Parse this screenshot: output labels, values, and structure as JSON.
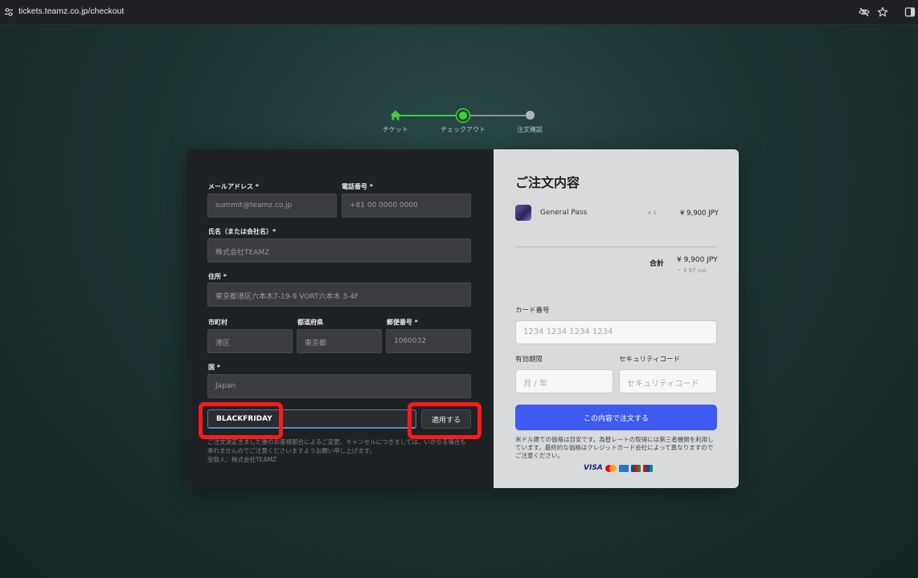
{
  "browser": {
    "url": "tickets.teamz.co.jp/checkout",
    "icons": [
      "site-settings-icon",
      "eye-off-icon",
      "star-icon",
      "sidebar-icon"
    ]
  },
  "stepper": {
    "steps": [
      {
        "label": "チケット",
        "icon": "home-icon",
        "state": "done"
      },
      {
        "label": "チェックアウト",
        "icon": "circle",
        "state": "current"
      },
      {
        "label": "注文確認",
        "icon": "dot",
        "state": "pending"
      }
    ],
    "colors": {
      "active": "#3fcf3f",
      "pending": "#b0b4b6"
    }
  },
  "form": {
    "email": {
      "label": "メールアドレス *",
      "value": "summit@teamz.co.jp"
    },
    "phone": {
      "label": "電話番号 *",
      "value": "+81 00 0000 0000"
    },
    "name": {
      "label": "氏名（または会社名）*",
      "value": "株式会社TEAMZ"
    },
    "address": {
      "label": "住所 *",
      "value": "東京都港区六本木7-19-9 VORT六本木 3-4F"
    },
    "city": {
      "label": "市町村",
      "value": "港区"
    },
    "prefecture": {
      "label": "都道府県",
      "value": "東京都"
    },
    "postal": {
      "label": "郵便番号 *",
      "value": "1060032"
    },
    "country": {
      "label": "国 *",
      "value": "Japan"
    },
    "coupon": {
      "value": "BLACKFRIDAY"
    },
    "apply_label": "適用する",
    "notice_lines": [
      "ご注文決定きました後のお客様都合によるご変更、キャンセルにつきましては、いかなる場合も",
      "承れませんのでご注意くださいますようお願い申し上げます。",
      "受取人：株式会社TEAMZ"
    ]
  },
  "summary": {
    "title": "ご注文内容",
    "item": {
      "name": "General Pass",
      "qty": "x 1",
      "price": "¥ 9,900 JPY"
    },
    "total_label": "合計",
    "total_value": "¥ 9,900 JPY",
    "total_usd": "~ $ 67",
    "total_usd_unit": "USD",
    "card_number": {
      "label": "カード番号",
      "placeholder": "1234 1234 1234 1234"
    },
    "expiry": {
      "label": "有効期限",
      "placeholder": "月 / 年"
    },
    "cvc": {
      "label": "セキュリティコード",
      "placeholder": "セキュリティコード"
    },
    "order_button": "この内容で注文する",
    "disclaimer": "米ドル建ての価格は目安です。為替レートの取得には第三者機関を利用しています。最終的な価格はクレジットカード会社によって異なりますのでご注意ください。",
    "card_brands": {
      "visa": "VISA",
      "others": [
        "mastercard-icon",
        "amex-icon",
        "jcb-icon",
        "unionpay-icon"
      ]
    },
    "colors": {
      "button": "#3d5af1"
    }
  },
  "annotations": {
    "highlight_color": "#ff1a1a"
  }
}
